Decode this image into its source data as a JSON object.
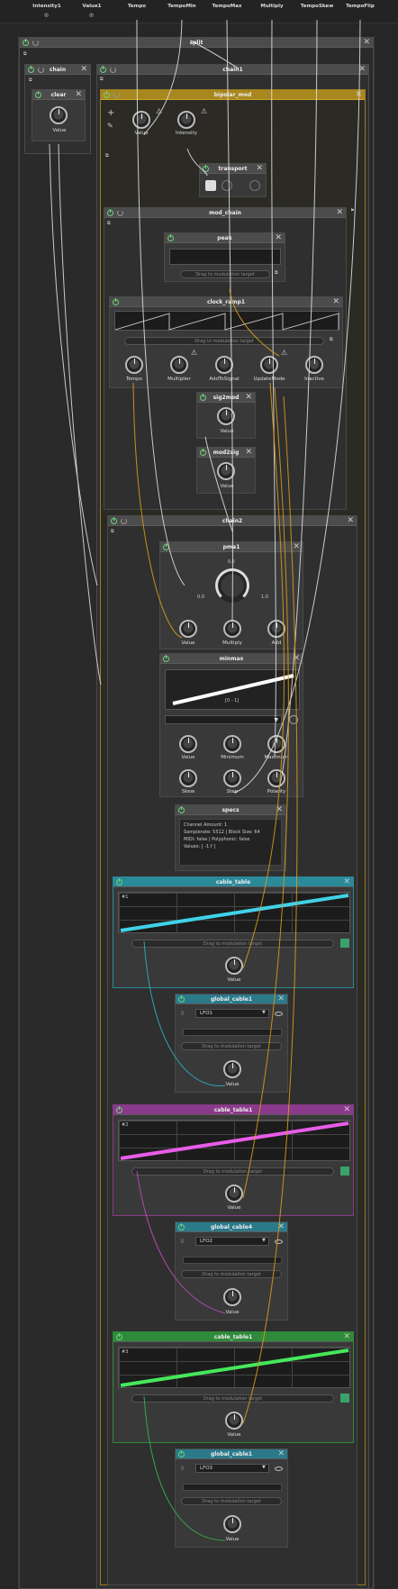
{
  "top_params": [
    "Intensity1",
    "Value1",
    "Tempo",
    "TempoMin",
    "TempoMax",
    "Multiply",
    "TempoSkew",
    "TempoFlip"
  ],
  "containers": {
    "split": "split",
    "chain": "chain",
    "chain1": "chain1",
    "bipolar_mod": "bipolar_mod",
    "mod_chain": "mod_chain",
    "chain2": "chain2"
  },
  "clear": {
    "title": "clear",
    "knob_label": "Value"
  },
  "bipolar": {
    "value_label": "Value",
    "intensity_label": "Intensity"
  },
  "transport": {
    "title": "transport"
  },
  "peak": {
    "title": "peak",
    "drag": "Drag to modulation target"
  },
  "clock_ramp": {
    "title": "clock_ramp1",
    "drag": "Drag to modulation target",
    "knobs": [
      "Tempo",
      "Multiplier",
      "AddToSignal",
      "UpdateMode",
      "Inactive"
    ]
  },
  "sig2mod": {
    "title": "sig2mod",
    "knob_label": "Value"
  },
  "mod2sig": {
    "title": "mod2sig",
    "knob_label": "Value"
  },
  "pma": {
    "title": "pma1",
    "scale": [
      "0.5",
      "0.0",
      "1.0"
    ],
    "knobs": [
      "Value",
      "Multiply",
      "Add"
    ]
  },
  "minmax": {
    "title": "minmax",
    "range_text": "[0 - 1]",
    "knobs_row1": [
      "Value",
      "Minimum",
      "Maximum"
    ],
    "knobs_row2": [
      "Skew",
      "Step",
      "Polarity"
    ]
  },
  "specs": {
    "title": "specs",
    "lines": [
      "Channel Amount: 1",
      "Samplerate: 5512 | Block Size: 64",
      "MIDI: false | Polyphonic: false",
      "Values: [ -1.f ]"
    ]
  },
  "cable_tables": [
    {
      "title": "cable_table",
      "index": "#1",
      "color": "#3fd2e8",
      "hdr": "#2a8a99",
      "drag": "Drag to modulation target",
      "knob": "Value"
    },
    {
      "title": "cable_table1",
      "index": "#2",
      "color": "#e85ce8",
      "hdr": "#8a3a8a",
      "drag": "Drag to modulation target",
      "knob": "Value"
    },
    {
      "title": "cable_table1",
      "index": "#3",
      "color": "#45e85a",
      "hdr": "#2f8a3a",
      "drag": "Drag to modulation target",
      "knob": "Value"
    }
  ],
  "global_cables": [
    {
      "title": "global_cable1",
      "lfo": "LFO1",
      "drag": "Drag to modulation target",
      "knob": "Value"
    },
    {
      "title": "global_cable4",
      "lfo": "LFO2",
      "drag": "Drag to modulation target",
      "knob": "Value"
    },
    {
      "title": "global_cable1",
      "lfo": "LFO3",
      "drag": "Drag to modulation target",
      "knob": "Value"
    }
  ],
  "colors": {
    "accent_gold": "#c9a227",
    "cable_white": "#e6e6e6",
    "cable_orange": "#d99a1c"
  }
}
